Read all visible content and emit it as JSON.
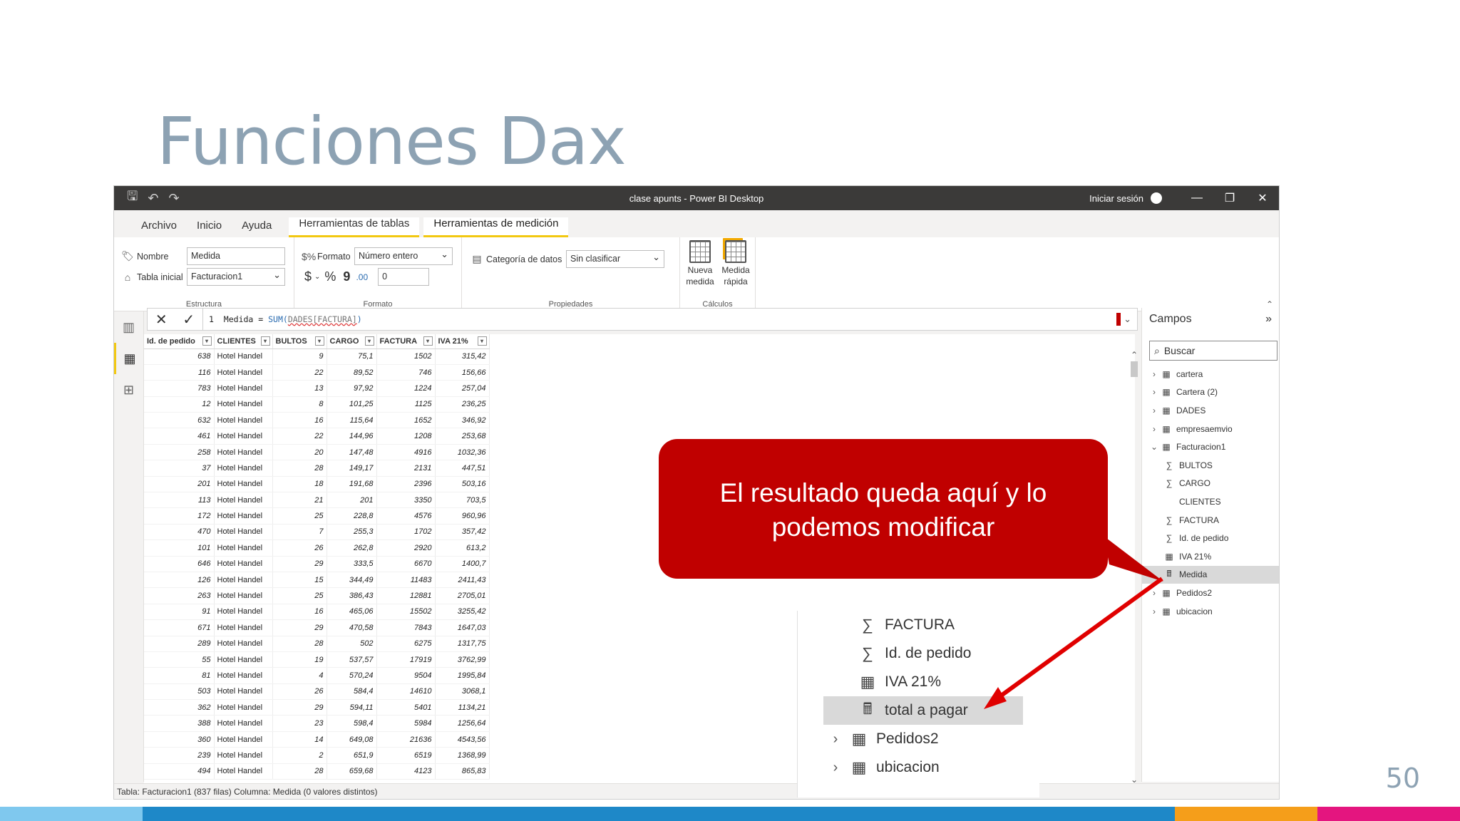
{
  "slide": {
    "title": "Funciones Dax",
    "page_number": "50",
    "footer_colors": [
      "#7fc8ee",
      "#1e88c8",
      "#f59e1a",
      "#e4157f"
    ]
  },
  "window": {
    "title": "clase apunts - Power BI Desktop",
    "sign_in": "Iniciar sesión",
    "controls": {
      "minimize": "—",
      "restore": "❐",
      "close": "✕"
    }
  },
  "ribbon_tabs": [
    {
      "label": "Archivo"
    },
    {
      "label": "Inicio"
    },
    {
      "label": "Ayuda"
    },
    {
      "label": "Herramientas de tablas"
    },
    {
      "label": "Herramientas de medición"
    }
  ],
  "ribbon": {
    "estructura": {
      "label": "Estructura",
      "nombre_label": "Nombre",
      "nombre_value": "Medida",
      "tabla_label": "Tabla inicial",
      "tabla_value": "Facturacion1"
    },
    "formato": {
      "label": "Formato",
      "formato_label": "Formato",
      "formato_value": "Número entero",
      "currency": "$",
      "percent": "%",
      "comma": "9",
      "decimals_icon": ".00",
      "decimals_value": "0"
    },
    "propiedades": {
      "label": "Propiedades",
      "categoria_label": "Categoría de datos",
      "categoria_value": "Sin clasificar"
    },
    "calculos": {
      "label": "Cálculos",
      "nueva_medida_l1": "Nueva",
      "nueva_medida_l2": "medida",
      "medida_rapida_l1": "Medida",
      "medida_rapida_l2": "rápida"
    }
  },
  "formula": {
    "line_number": "1",
    "prefix": "Medida = ",
    "function": "SUM(",
    "table_ref": "DADES",
    "column_ref": "[FACTURA]",
    "suffix": ")"
  },
  "table": {
    "columns": [
      "Id. de pedido",
      "CLIENTES",
      "BULTOS",
      "CARGO",
      "FACTURA",
      "IVA 21%"
    ],
    "rows": [
      [
        "638",
        "Hotel Handel",
        "9",
        "75,1",
        "1502",
        "315,42"
      ],
      [
        "116",
        "Hotel Handel",
        "22",
        "89,52",
        "746",
        "156,66"
      ],
      [
        "783",
        "Hotel Handel",
        "13",
        "97,92",
        "1224",
        "257,04"
      ],
      [
        "12",
        "Hotel Handel",
        "8",
        "101,25",
        "1125",
        "236,25"
      ],
      [
        "632",
        "Hotel Handel",
        "16",
        "115,64",
        "1652",
        "346,92"
      ],
      [
        "461",
        "Hotel Handel",
        "22",
        "144,96",
        "1208",
        "253,68"
      ],
      [
        "258",
        "Hotel Handel",
        "20",
        "147,48",
        "4916",
        "1032,36"
      ],
      [
        "37",
        "Hotel Handel",
        "28",
        "149,17",
        "2131",
        "447,51"
      ],
      [
        "201",
        "Hotel Handel",
        "18",
        "191,68",
        "2396",
        "503,16"
      ],
      [
        "113",
        "Hotel Handel",
        "21",
        "201",
        "3350",
        "703,5"
      ],
      [
        "172",
        "Hotel Handel",
        "25",
        "228,8",
        "4576",
        "960,96"
      ],
      [
        "470",
        "Hotel Handel",
        "7",
        "255,3",
        "1702",
        "357,42"
      ],
      [
        "101",
        "Hotel Handel",
        "26",
        "262,8",
        "2920",
        "613,2"
      ],
      [
        "646",
        "Hotel Handel",
        "29",
        "333,5",
        "6670",
        "1400,7"
      ],
      [
        "126",
        "Hotel Handel",
        "15",
        "344,49",
        "11483",
        "2411,43"
      ],
      [
        "263",
        "Hotel Handel",
        "25",
        "386,43",
        "12881",
        "2705,01"
      ],
      [
        "91",
        "Hotel Handel",
        "16",
        "465,06",
        "15502",
        "3255,42"
      ],
      [
        "671",
        "Hotel Handel",
        "29",
        "470,58",
        "7843",
        "1647,03"
      ],
      [
        "289",
        "Hotel Handel",
        "28",
        "502",
        "6275",
        "1317,75"
      ],
      [
        "55",
        "Hotel Handel",
        "19",
        "537,57",
        "17919",
        "3762,99"
      ],
      [
        "81",
        "Hotel Handel",
        "4",
        "570,24",
        "9504",
        "1995,84"
      ],
      [
        "503",
        "Hotel Handel",
        "26",
        "584,4",
        "14610",
        "3068,1"
      ],
      [
        "362",
        "Hotel Handel",
        "29",
        "594,11",
        "5401",
        "1134,21"
      ],
      [
        "388",
        "Hotel Handel",
        "23",
        "598,4",
        "5984",
        "1256,64"
      ],
      [
        "360",
        "Hotel Handel",
        "14",
        "649,08",
        "21636",
        "4543,56"
      ],
      [
        "239",
        "Hotel Handel",
        "2",
        "651,9",
        "6519",
        "1368,99"
      ],
      [
        "494",
        "Hotel Handel",
        "28",
        "659,68",
        "4123",
        "865,83"
      ]
    ]
  },
  "fields_pane": {
    "title": "Campos",
    "search_placeholder": "Buscar",
    "items": [
      {
        "label": "cartera",
        "icon": "table-icon",
        "level": 0,
        "twist": "›"
      },
      {
        "label": "Cartera (2)",
        "icon": "table-icon",
        "level": 0,
        "twist": "›"
      },
      {
        "label": "DADES",
        "icon": "table-icon",
        "level": 0,
        "twist": "›"
      },
      {
        "label": "empresaemvio",
        "icon": "table-icon",
        "level": 0,
        "twist": "›"
      },
      {
        "label": "Facturacion1",
        "icon": "table-icon",
        "level": 0,
        "twist": "⌄"
      },
      {
        "label": "BULTOS",
        "icon": "sigma-icon",
        "level": 1
      },
      {
        "label": "CARGO",
        "icon": "sigma-icon",
        "level": 1
      },
      {
        "label": "CLIENTES",
        "icon": "",
        "level": 1
      },
      {
        "label": "FACTURA",
        "icon": "sigma-icon",
        "level": 1
      },
      {
        "label": "Id. de pedido",
        "icon": "sigma-icon",
        "level": 1
      },
      {
        "label": "IVA 21%",
        "icon": "calc-column-icon",
        "level": 1
      },
      {
        "label": "Medida",
        "icon": "calculator-icon",
        "level": 1,
        "selected": true
      },
      {
        "label": "Pedidos2",
        "icon": "table-icon",
        "level": 0,
        "twist": "›"
      },
      {
        "label": "ubicacion",
        "icon": "table-icon",
        "level": 0,
        "twist": "›"
      }
    ]
  },
  "callout": {
    "line1": "El resultado queda aquí y lo",
    "line2": "podemos modificar",
    "color": "#c00000"
  },
  "zoom_inset": {
    "items": [
      {
        "label": "FACTURA",
        "icon": "sigma-icon",
        "level": 1
      },
      {
        "label": "Id. de pedido",
        "icon": "sigma-icon",
        "level": 1
      },
      {
        "label": "IVA 21%",
        "icon": "calc-column-icon",
        "level": 1
      },
      {
        "label": "total a pagar",
        "icon": "calculator-icon",
        "level": 1,
        "selected": true
      },
      {
        "label": "Pedidos2",
        "icon": "table-icon",
        "level": 0,
        "twist": "›"
      },
      {
        "label": "ubicacion",
        "icon": "table-icon",
        "level": 0,
        "twist": "›"
      }
    ]
  },
  "status": {
    "text": "Tabla: Facturacion1 (837 filas) Columna: Medida (0 valores distintos)"
  }
}
